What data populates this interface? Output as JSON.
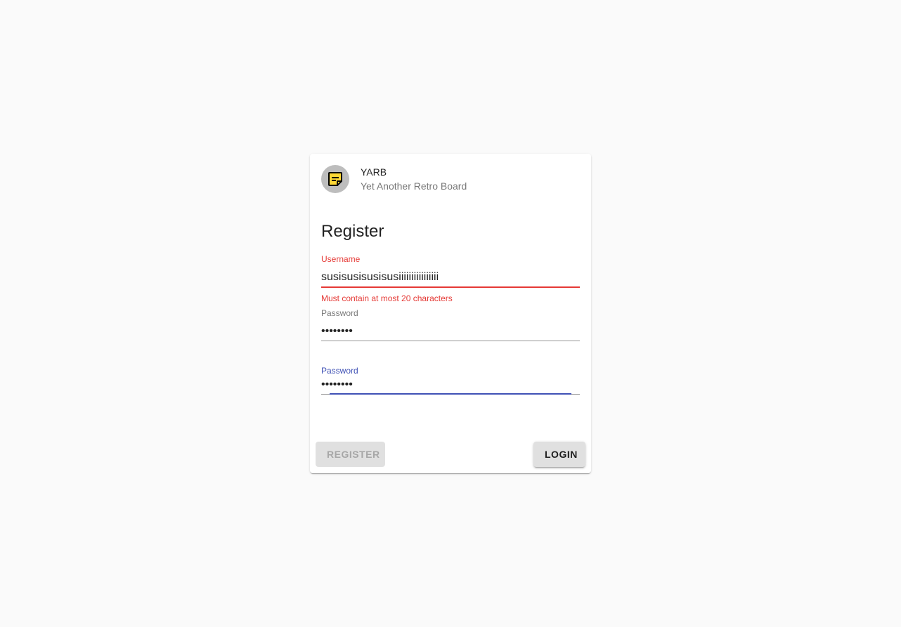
{
  "header": {
    "title": "YARB",
    "subtitle": "Yet Another Retro Board",
    "avatar_icon": "sticky-note-icon"
  },
  "form": {
    "title": "Register",
    "username": {
      "label": "Username",
      "value": "susisusisusisusiiiiiiiiiiiiiiii",
      "error": "Must contain at most 20 characters"
    },
    "password": {
      "label": "Password",
      "value": "secret12"
    },
    "password_repeat": {
      "label": "Password",
      "value": "secret12"
    }
  },
  "actions": {
    "register_label": "Register",
    "login_label": "Login"
  },
  "colors": {
    "error": "#e53935",
    "focus": "#3f51b5",
    "icon_fill": "#fdd835"
  }
}
